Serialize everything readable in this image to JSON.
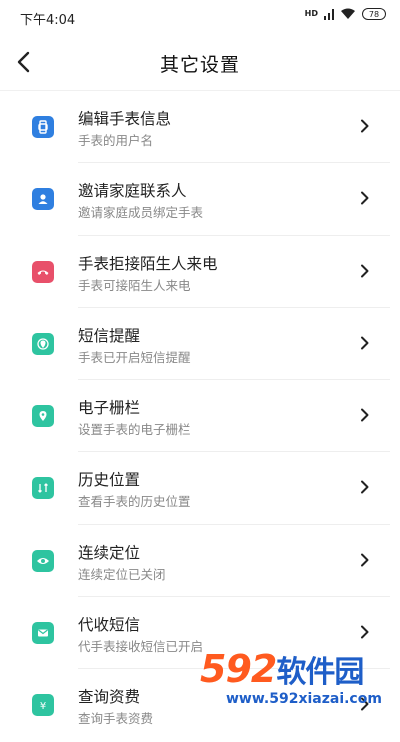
{
  "status_bar": {
    "time": "下午4:04",
    "signal_text": "HD",
    "battery": "78"
  },
  "header": {
    "title": "其它设置"
  },
  "items": [
    {
      "title": "编辑手表信息",
      "subtitle": "手表的用户名",
      "icon": "watch-icon",
      "color": "#2f7fe0"
    },
    {
      "title": "邀请家庭联系人",
      "subtitle": "邀请家庭成员绑定手表",
      "icon": "contact-icon",
      "color": "#2f7fe0"
    },
    {
      "title": "手表拒接陌生人来电",
      "subtitle": "手表可接陌生人来电",
      "icon": "phone-reject-icon",
      "color": "#e8506a"
    },
    {
      "title": "短信提醒",
      "subtitle": "手表已开启短信提醒",
      "icon": "sms-alert-icon",
      "color": "#2ec4a0"
    },
    {
      "title": "电子栅栏",
      "subtitle": "设置手表的电子栅栏",
      "icon": "geofence-icon",
      "color": "#2ec4a0"
    },
    {
      "title": "历史位置",
      "subtitle": "查看手表的历史位置",
      "icon": "history-location-icon",
      "color": "#2ec4a0"
    },
    {
      "title": "连续定位",
      "subtitle": "连续定位已关闭",
      "icon": "continuous-locate-icon",
      "color": "#2ec4a0"
    },
    {
      "title": "代收短信",
      "subtitle": "代手表接收短信已开启",
      "icon": "mail-icon",
      "color": "#2ec4a0"
    },
    {
      "title": "查询资费",
      "subtitle": "查询手表资费",
      "icon": "yuan-icon",
      "color": "#2ec4a0"
    }
  ],
  "watermark": {
    "number": "592",
    "name": "软件园",
    "url": "www.592xiazai.com"
  }
}
